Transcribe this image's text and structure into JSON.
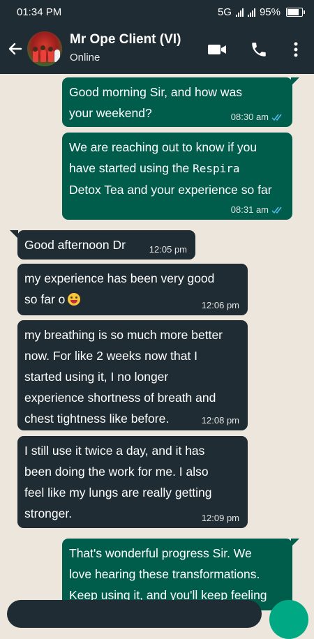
{
  "status_bar": {
    "time": "01:34 PM",
    "network": "5G",
    "battery": "95%",
    "battery_level": 0.95
  },
  "header": {
    "contact_name": "Mr Ope Client (VI)",
    "status": "Online",
    "icons": [
      "back-arrow-icon",
      "video-call-icon",
      "phone-icon",
      "more-options-icon"
    ]
  },
  "messages": [
    {
      "direction": "outgoing",
      "text": "Good morning Sir, and how was\nyour weekend?",
      "time": "08:30 am",
      "read": true
    },
    {
      "direction": "outgoing",
      "text_a": "We are reaching out to know if you\nhave started using the ",
      "text_b": "Respira",
      "text_c": "\nDetox Tea and your experience so far",
      "time": "08:31 am",
      "read": true
    },
    {
      "direction": "incoming",
      "text": "Good afternoon Dr",
      "time": "12:05 pm"
    },
    {
      "direction": "incoming",
      "text": "my experience has been very good\nso far o",
      "emoji": "grinning-face",
      "time": "12:06 pm"
    },
    {
      "direction": "incoming",
      "text": "my breathing is so much more better\nnow. For like 2 weeks now that I\nstarted using it, I no longer\nexperience shortness of breath and\nchest tightness like before.",
      "time": "12:08 pm"
    },
    {
      "direction": "incoming",
      "text": "I still use it twice a day, and it has\nbeen doing the work for me. I also\nfeel like my lungs are really getting\nstronger.",
      "time": "12:09 pm"
    },
    {
      "direction": "outgoing",
      "text": "That's wonderful progress Sir. We\nlove hearing these transformations.\nKeep using it, and you'll keep feeling"
    }
  ],
  "colors": {
    "header_bg": "#1f2c33",
    "chat_bg": "#ece6dd",
    "outgoing_bubble": "#005c4b",
    "incoming_bubble": "#1f2c33",
    "read_ticks": "#53bdeb",
    "accent": "#00a884"
  }
}
